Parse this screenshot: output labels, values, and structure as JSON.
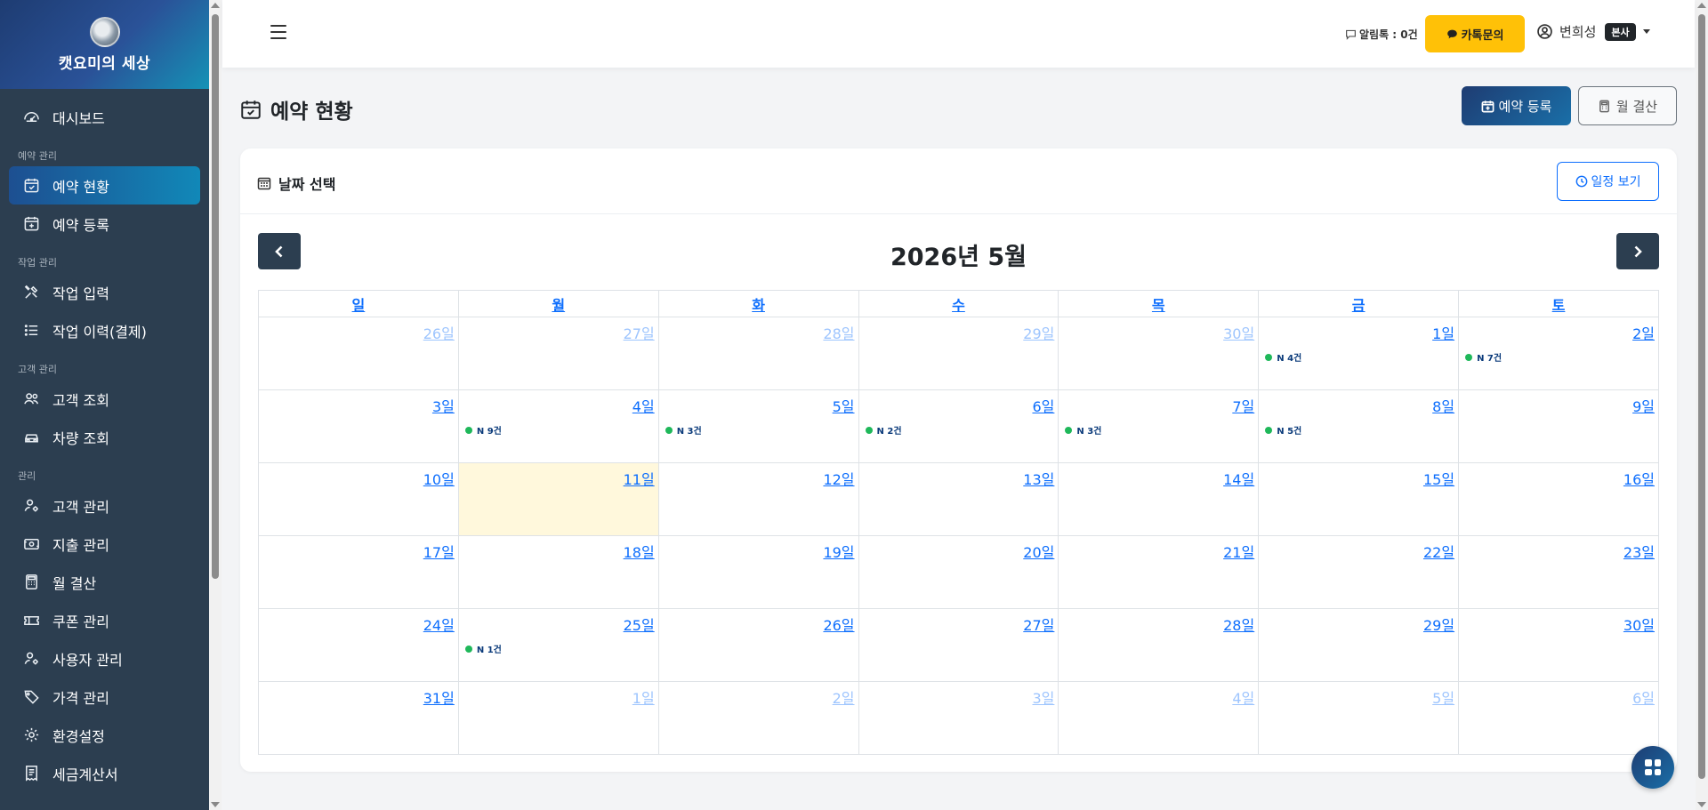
{
  "brand": {
    "name": "캣요미의 세상"
  },
  "sidebar": {
    "items": [
      {
        "type": "item",
        "label": "대시보드",
        "icon": "dashboard-icon",
        "name": "sidebar-item-dashboard"
      },
      {
        "type": "section",
        "label": "예약 관리"
      },
      {
        "type": "item",
        "label": "예약 현황",
        "icon": "calendar-check-icon",
        "name": "sidebar-item-reservation-status",
        "active": true
      },
      {
        "type": "item",
        "label": "예약 등록",
        "icon": "calendar-plus-icon",
        "name": "sidebar-item-reservation-register"
      },
      {
        "type": "section",
        "label": "작업 관리"
      },
      {
        "type": "item",
        "label": "작업 입력",
        "icon": "tools-icon",
        "name": "sidebar-item-work-input"
      },
      {
        "type": "item",
        "label": "작업 이력(결제)",
        "icon": "list-icon",
        "name": "sidebar-item-work-history"
      },
      {
        "type": "section",
        "label": "고객 관리"
      },
      {
        "type": "item",
        "label": "고객 조회",
        "icon": "people-icon",
        "name": "sidebar-item-customer-search"
      },
      {
        "type": "item",
        "label": "차량 조회",
        "icon": "car-icon",
        "name": "sidebar-item-vehicle-search"
      },
      {
        "type": "section",
        "label": "관리"
      },
      {
        "type": "item",
        "label": "고객 관리",
        "icon": "person-gear-icon",
        "name": "sidebar-item-customer-manage"
      },
      {
        "type": "item",
        "label": "지출 관리",
        "icon": "cash-icon",
        "name": "sidebar-item-expense-manage"
      },
      {
        "type": "item",
        "label": "월 결산",
        "icon": "calculator-icon",
        "name": "sidebar-item-monthly-settlement"
      },
      {
        "type": "item",
        "label": "쿠폰 관리",
        "icon": "ticket-icon",
        "name": "sidebar-item-coupon-manage"
      },
      {
        "type": "item",
        "label": "사용자 관리",
        "icon": "person-gear-icon",
        "name": "sidebar-item-user-manage"
      },
      {
        "type": "item",
        "label": "가격 관리",
        "icon": "tags-icon",
        "name": "sidebar-item-price-manage"
      },
      {
        "type": "item",
        "label": "환경설정",
        "icon": "gear-icon",
        "name": "sidebar-item-settings"
      },
      {
        "type": "item",
        "label": "세금계산서",
        "icon": "receipt-icon",
        "name": "sidebar-item-tax-invoice"
      }
    ]
  },
  "topbar": {
    "alimtalk": "알림톡 : 0건",
    "kakao_label": "카톡문의",
    "user_name": "변희성",
    "branch_badge": "본사"
  },
  "page": {
    "title": "예약 현황",
    "register_label": "예약 등록",
    "settlement_label": "월 결산"
  },
  "card": {
    "title": "날짜 선택",
    "schedule_label": "일정 보기"
  },
  "calendar": {
    "title": "2026년 5월",
    "weekdays": [
      "일",
      "월",
      "화",
      "수",
      "목",
      "금",
      "토"
    ],
    "weeks": [
      [
        {
          "label": "26일",
          "other": true
        },
        {
          "label": "27일",
          "other": true
        },
        {
          "label": "28일",
          "other": true
        },
        {
          "label": "29일",
          "other": true
        },
        {
          "label": "30일",
          "other": true
        },
        {
          "label": "1일",
          "event": "N 4건"
        },
        {
          "label": "2일",
          "event": "N 7건"
        }
      ],
      [
        {
          "label": "3일"
        },
        {
          "label": "4일",
          "event": "N 9건"
        },
        {
          "label": "5일",
          "event": "N 3건"
        },
        {
          "label": "6일",
          "event": "N 2건"
        },
        {
          "label": "7일",
          "event": "N 3건"
        },
        {
          "label": "8일",
          "event": "N 5건"
        },
        {
          "label": "9일"
        }
      ],
      [
        {
          "label": "10일"
        },
        {
          "label": "11일",
          "today": true
        },
        {
          "label": "12일"
        },
        {
          "label": "13일"
        },
        {
          "label": "14일"
        },
        {
          "label": "15일"
        },
        {
          "label": "16일"
        }
      ],
      [
        {
          "label": "17일"
        },
        {
          "label": "18일"
        },
        {
          "label": "19일"
        },
        {
          "label": "20일"
        },
        {
          "label": "21일"
        },
        {
          "label": "22일"
        },
        {
          "label": "23일"
        }
      ],
      [
        {
          "label": "24일"
        },
        {
          "label": "25일",
          "event": "N 1건"
        },
        {
          "label": "26일"
        },
        {
          "label": "27일"
        },
        {
          "label": "28일"
        },
        {
          "label": "29일"
        },
        {
          "label": "30일"
        }
      ],
      [
        {
          "label": "31일"
        },
        {
          "label": "1일",
          "other": true
        },
        {
          "label": "2일",
          "other": true
        },
        {
          "label": "3일",
          "other": true
        },
        {
          "label": "4일",
          "other": true
        },
        {
          "label": "5일",
          "other": true
        },
        {
          "label": "6일",
          "other": true
        }
      ]
    ]
  },
  "colors": {
    "sidebar_bg": "#2c3e50",
    "accent": "#0d6efd",
    "kakao": "#ffc107",
    "today_bg": "#fff8dc",
    "event_dot": "#1fb85a"
  }
}
